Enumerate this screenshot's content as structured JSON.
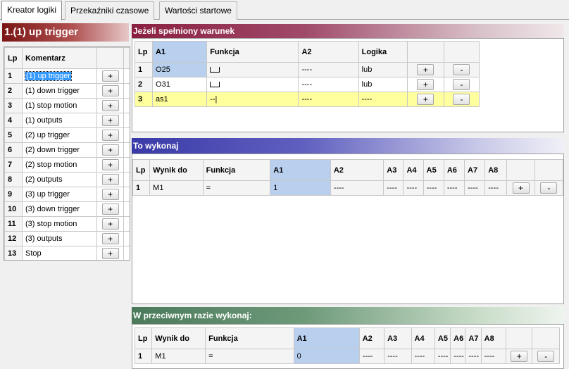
{
  "tabs": [
    "Kreator logiki",
    "Przekaźniki czasowe",
    "Wartości startowe"
  ],
  "left": {
    "title": "1.(1) up trigger",
    "headers": {
      "lp": "Lp",
      "comment": "Komentarz"
    },
    "rows": [
      {
        "lp": "1",
        "comment": "(1) up trigger"
      },
      {
        "lp": "2",
        "comment": "(1) down trigger"
      },
      {
        "lp": "3",
        "comment": "(1) stop motion"
      },
      {
        "lp": "4",
        "comment": "(1) outputs"
      },
      {
        "lp": "5",
        "comment": "(2) up trigger"
      },
      {
        "lp": "6",
        "comment": "(2) down trigger"
      },
      {
        "lp": "7",
        "comment": "(2) stop motion"
      },
      {
        "lp": "8",
        "comment": "(2) outputs"
      },
      {
        "lp": "9",
        "comment": "(3) up trigger"
      },
      {
        "lp": "10",
        "comment": "(3) down trigger"
      },
      {
        "lp": "11",
        "comment": "(3) stop motion"
      },
      {
        "lp": "12",
        "comment": "(3) outputs"
      },
      {
        "lp": "13",
        "comment": "Stop"
      }
    ],
    "plus": "+"
  },
  "cond": {
    "title": "Jeżeli spełniony warunek",
    "headers": {
      "lp": "Lp",
      "a1": "A1",
      "fn": "Funkcja",
      "a2": "A2",
      "logic": "Logika"
    },
    "rows": [
      {
        "lp": "1",
        "a1": "O25",
        "fn": "",
        "a2": "----",
        "logic": "lub"
      },
      {
        "lp": "2",
        "a1": "O31",
        "fn": "",
        "a2": "----",
        "logic": "lub"
      },
      {
        "lp": "3",
        "a1": "as1",
        "fn": "--|",
        "a2": "----",
        "logic": "----"
      }
    ],
    "plus": "+",
    "minus": "-"
  },
  "then": {
    "title": "To wykonaj",
    "headers": {
      "lp": "Lp",
      "out": "Wynik do",
      "fn": "Funkcja",
      "a1": "A1",
      "a2": "A2",
      "a3": "A3",
      "a4": "A4",
      "a5": "A5",
      "a6": "A6",
      "a7": "A7",
      "a8": "A8"
    },
    "row": {
      "lp": "1",
      "out": "M1",
      "fn": "=",
      "a1": "1",
      "a2": "----",
      "a3": "----",
      "a4": "----",
      "a5": "----",
      "a6": "----",
      "a7": "----",
      "a8": "----"
    },
    "plus": "+",
    "minus": "-"
  },
  "else": {
    "title": "W przeciwnym razie wykonaj:",
    "headers": {
      "lp": "Lp",
      "out": "Wynik do",
      "fn": "Funkcja",
      "a1": "A1",
      "a2": "A2",
      "a3": "A3",
      "a4": "A4",
      "a5": "A5",
      "a6": "A6",
      "a7": "A7",
      "a8": "A8"
    },
    "row": {
      "lp": "1",
      "out": "M1",
      "fn": "=",
      "a1": "0",
      "a2": "----",
      "a3": "----",
      "a4": "----",
      "a5": "----",
      "a6": "----",
      "a7": "----",
      "a8": "----"
    },
    "plus": "+",
    "minus": "-"
  }
}
